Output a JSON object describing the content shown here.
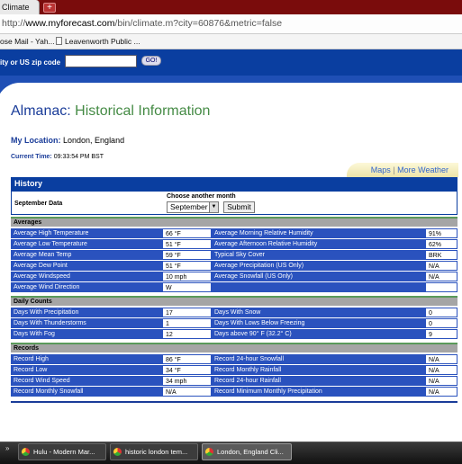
{
  "browser": {
    "tab_title": "Climate",
    "new_tab": "+",
    "url_prefix": "http://",
    "url_domain": "www.myforecast.com",
    "url_path": "/bin/climate.m?city=60876&metric=false",
    "bookmarks": [
      "ose Mail - Yah...",
      "Leavenworth Public ..."
    ]
  },
  "search": {
    "label": "ity or US zip code",
    "go_label": "GO!",
    "value": ""
  },
  "page": {
    "title_part1": "Almanac:",
    "title_part2": "Historical Information",
    "location_label": "My Location:",
    "location_value": "London, England",
    "time_label": "Current Time:",
    "time_value": "09:33:54 PM BST",
    "tab_links": {
      "maps": "Maps",
      "separator": "|",
      "more_weather": "More Weather"
    }
  },
  "history": {
    "title": "History",
    "period_label": "September Data",
    "choose_label": "Choose another month",
    "selected_month": "September",
    "submit_label": "Submit",
    "sections": [
      {
        "name": "Averages",
        "rows": [
          [
            "Average High Temperature",
            "66 °F",
            "Average Morning Relative Humidity",
            "91%"
          ],
          [
            "Average Low Temperature",
            "51 °F",
            "Average Afternoon Relative Humidity",
            "62%"
          ],
          [
            "Average Mean Temp",
            "59 °F",
            "Typical Sky Cover",
            "BRK"
          ],
          [
            "Average Dew Point",
            "51 °F",
            "Average Precipitation (US Only)",
            "N/A"
          ],
          [
            "Average Windspeed",
            "10 mph",
            "Average Snowfall (US Only)",
            "N/A"
          ],
          [
            "Average Wind Direction",
            "W",
            "",
            ""
          ]
        ]
      },
      {
        "name": "Daily Counts",
        "rows": [
          [
            "Days With Precipitation",
            "17",
            "Days With Snow",
            "0"
          ],
          [
            "Days With Thunderstorms",
            "1",
            "Days With Lows Below Freezing",
            "0"
          ],
          [
            "Days With Fog",
            "12",
            "Days above 90° F (32.2° C)",
            "9"
          ]
        ]
      },
      {
        "name": "Records",
        "rows": [
          [
            "Record High",
            "86 °F",
            "Record 24-hour Snowfall",
            "N/A"
          ],
          [
            "Record Low",
            "34 °F",
            "Record Monthly Rainfall",
            "N/A"
          ],
          [
            "Record Wind Speed",
            "34 mph",
            "Record 24-hour Rainfall",
            "N/A"
          ],
          [
            "Record Monthly Snowfall",
            "N/A",
            "Record Minimum Monthly Precipitation",
            "N/A"
          ]
        ]
      }
    ]
  },
  "taskbar": {
    "arrow": "»",
    "items": [
      "Hulu - Modern Mar...",
      "historic london tem...",
      "London, England Cli..."
    ]
  }
}
